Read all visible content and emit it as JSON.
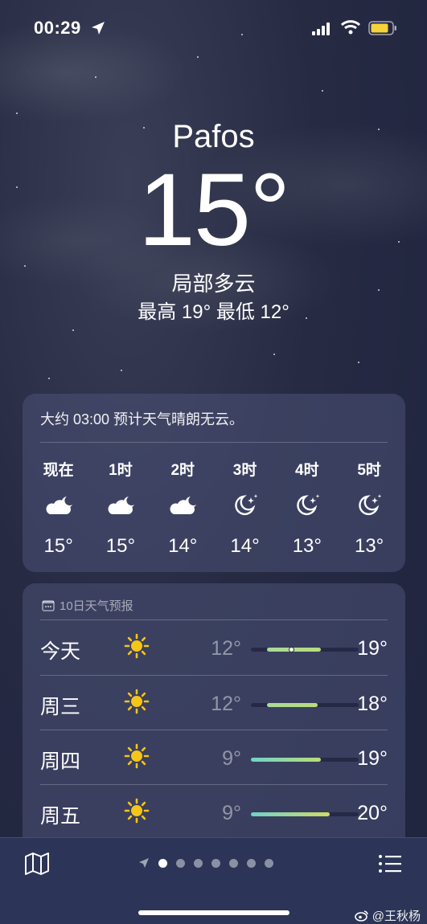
{
  "status_bar": {
    "time": "00:29"
  },
  "location": {
    "city": "Pafos",
    "temperature": "15°",
    "condition": "局部多云",
    "high_low": "最高 19°  最低 12°"
  },
  "hourly": {
    "summary": "大约 03:00 预计天气晴朗无云。",
    "hours": [
      {
        "label": "现在",
        "icon": "partly-cloudy-night-icon",
        "temp": "15°"
      },
      {
        "label": "1时",
        "icon": "partly-cloudy-night-icon",
        "temp": "15°"
      },
      {
        "label": "2时",
        "icon": "partly-cloudy-night-icon",
        "temp": "14°"
      },
      {
        "label": "3时",
        "icon": "clear-night-icon",
        "temp": "14°"
      },
      {
        "label": "4时",
        "icon": "clear-night-icon",
        "temp": "13°"
      },
      {
        "label": "5时",
        "icon": "clear-night-icon",
        "temp": "13°"
      }
    ]
  },
  "ten_day": {
    "title": "10日天气预报",
    "days": [
      {
        "day": "今天",
        "icon": "sun-icon",
        "low": "12°",
        "high": "19°",
        "range_start": 0.15,
        "range_end": 0.65,
        "current": 0.38,
        "color_from": "#a9d99a",
        "color_to": "#b9dc7a"
      },
      {
        "day": "周三",
        "icon": "sun-icon",
        "low": "12°",
        "high": "18°",
        "range_start": 0.15,
        "range_end": 0.62,
        "color_from": "#a9d99a",
        "color_to": "#b9dc7a"
      },
      {
        "day": "周四",
        "icon": "sun-icon",
        "low": "9°",
        "high": "19°",
        "range_start": 0.0,
        "range_end": 0.65,
        "color_from": "#6fd3c8",
        "color_to": "#b9dc7a"
      },
      {
        "day": "周五",
        "icon": "sun-icon",
        "low": "9°",
        "high": "20°",
        "range_start": 0.0,
        "range_end": 0.73,
        "color_from": "#6fd3c8",
        "color_to": "#cfdc63"
      }
    ]
  },
  "tab_bar": {
    "pages": 7,
    "active_page": 0
  },
  "watermark": "@王秋杨",
  "colors": {
    "background": "#262a42",
    "card": "#4c5278",
    "tabbar": "#2c3557",
    "sun": "#f5c518"
  }
}
